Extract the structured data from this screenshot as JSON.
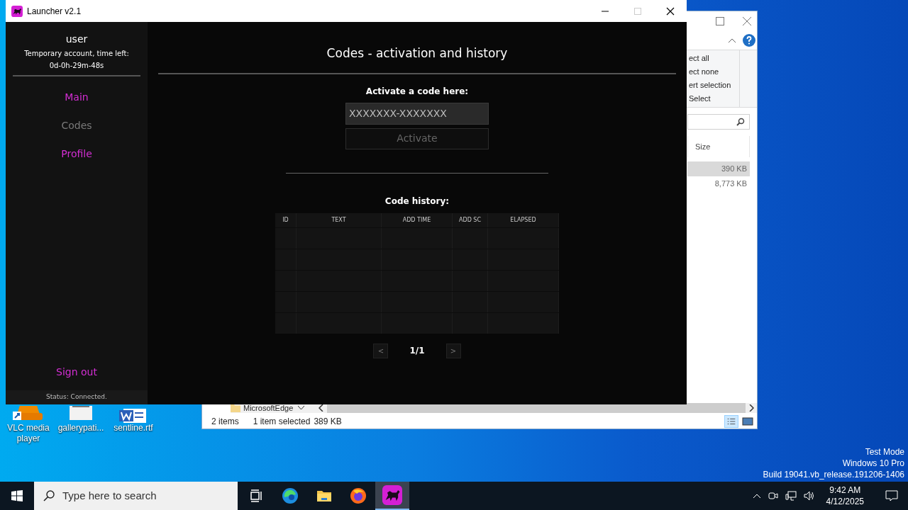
{
  "launcher": {
    "title": "Launcher v2.1",
    "sidebar": {
      "username": "user",
      "account_note": "Temporary account, time left:",
      "time_left": "0d-0h-29m-48s",
      "nav": [
        {
          "label": "Main",
          "selected": false
        },
        {
          "label": "Codes",
          "selected": true
        },
        {
          "label": "Profile",
          "selected": false
        }
      ],
      "sign_out": "Sign out",
      "status": "Status: Connected."
    },
    "main": {
      "heading": "Codes - activation and history",
      "activate_label": "Activate a code here:",
      "code_field": {
        "placeholder": "XXXXXXX-XXXXXXX"
      },
      "activate_button": {
        "label": "Activate",
        "disabled": true
      },
      "history_label": "Code history:",
      "table": {
        "columns": [
          "ID",
          "TEXT",
          "ADD TIME",
          "ADD SC",
          "ELAPSED"
        ]
      },
      "pagination": {
        "prev": "<",
        "page": "1/1",
        "next": ">"
      }
    }
  },
  "explorer": {
    "ribbon_items": [
      "ect all",
      "ect none",
      "ert selection",
      "Select"
    ],
    "columns": [
      "Size"
    ],
    "rows": [
      {
        "size": "390 KB",
        "selected": true
      },
      {
        "size": "8,773 KB",
        "selected": false
      }
    ],
    "nav_item": "MicrosoftEdge",
    "status": [
      "2 items",
      "1 item selected",
      "389 KB"
    ]
  },
  "desktop": {
    "icons": [
      {
        "label": "VLC media player",
        "kind": "vlc"
      },
      {
        "label": "gallerypati...",
        "kind": "image"
      },
      {
        "label": "sentline.rtf",
        "kind": "word"
      }
    ],
    "watermark_lines": [
      "Test Mode",
      "Windows 10 Pro",
      "Build 19041.vb_release.191206-1406"
    ]
  },
  "taskbar": {
    "search": {
      "placeholder": "Type here to search"
    },
    "apps": [
      {
        "kind": "taskview",
        "selected": false
      },
      {
        "kind": "edge",
        "selected": false
      },
      {
        "kind": "folder",
        "selected": false
      },
      {
        "kind": "firefox",
        "selected": false
      },
      {
        "kind": "launcher",
        "selected": true
      }
    ],
    "time": "9:42 AM",
    "date": "4/12/2025"
  }
}
